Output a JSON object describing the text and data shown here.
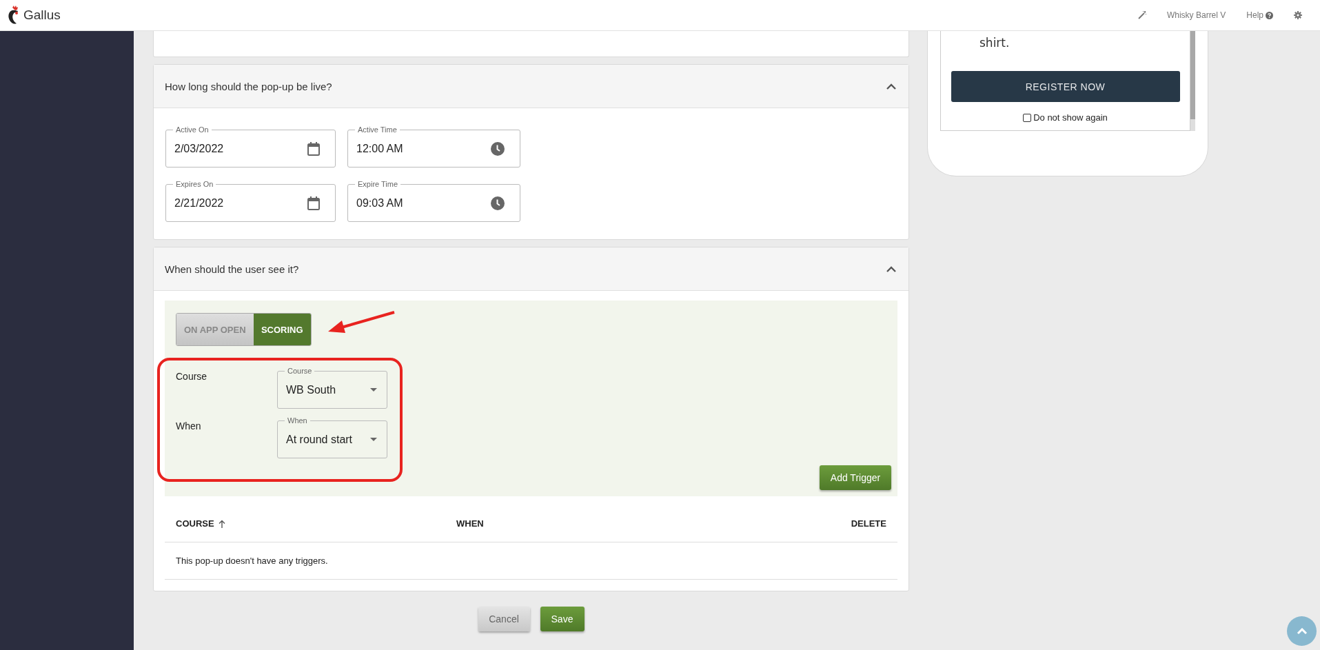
{
  "header": {
    "brand": "Gallus",
    "account": "Whisky Barrel V",
    "help": "Help"
  },
  "preview": {
    "text": "shirt.",
    "button": "REGISTER NOW",
    "checkbox": {
      "label": "Do not show again",
      "checked": false
    }
  },
  "live_section": {
    "title": "How long should the pop-up be live?",
    "expanded": true,
    "fields": [
      {
        "kind": "date",
        "label": "Active On",
        "value": "2/03/2022"
      },
      {
        "kind": "time",
        "label": "Active Time",
        "value": "12:00 AM"
      },
      {
        "kind": "date",
        "label": "Expires On",
        "value": "2/21/2022"
      },
      {
        "kind": "time",
        "label": "Expire Time",
        "value": "09:03 AM"
      }
    ]
  },
  "trigger_section": {
    "title": "When should the user see it?",
    "expanded": true,
    "modes": [
      {
        "label": "ON APP OPEN",
        "selected": false
      },
      {
        "label": "SCORING",
        "selected": true
      }
    ],
    "selects": [
      {
        "row_label": "Course",
        "label": "Course",
        "value": "WB South"
      },
      {
        "row_label": "When",
        "label": "When",
        "value": "At round start"
      }
    ],
    "add_button": "Add Trigger",
    "table": {
      "columns": [
        {
          "label": "COURSE",
          "sorted": true
        },
        {
          "label": "WHEN",
          "sorted": false
        },
        {
          "label": "DELETE",
          "sorted": false
        }
      ],
      "empty": "This pop-up doesn't have any triggers."
    }
  },
  "buttons": [
    {
      "kind": "cancel",
      "label": "Cancel"
    },
    {
      "kind": "save",
      "label": "Save"
    }
  ]
}
